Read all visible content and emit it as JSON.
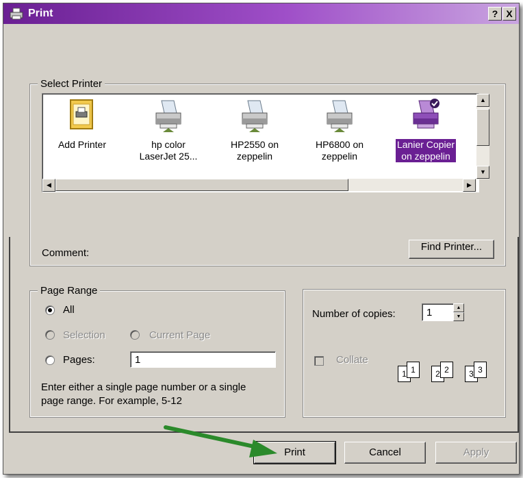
{
  "window": {
    "title": "Print",
    "help_label": "?",
    "close_label": "X"
  },
  "select_printer": {
    "legend": "Select Printer",
    "printers": [
      {
        "label_line1": "Add Printer",
        "label_line2": "",
        "icon": "add-printer-icon",
        "selected": false
      },
      {
        "label_line1": "hp color",
        "label_line2": "LaserJet 25...",
        "icon": "printer-icon",
        "selected": false
      },
      {
        "label_line1": "HP2550 on",
        "label_line2": "zeppelin",
        "icon": "printer-icon",
        "selected": false
      },
      {
        "label_line1": "HP6800 on",
        "label_line2": "zeppelin",
        "icon": "printer-icon",
        "selected": false
      },
      {
        "label_line1": "Lanier Copier",
        "label_line2": "on zeppelin",
        "icon": "default-printer-icon",
        "selected": true
      }
    ],
    "comment_label": "Comment:",
    "find_printer_label": "Find Printer..."
  },
  "page_range": {
    "legend": "Page Range",
    "all_label": "All",
    "selection_label": "Selection",
    "current_page_label": "Current Page",
    "pages_label": "Pages:",
    "pages_value": "1",
    "hint_line1": "Enter either a single page number or a single",
    "hint_line2": "page range.  For example, 5-12",
    "selected_option": "All"
  },
  "copies": {
    "number_label": "Number of copies:",
    "number_value": "1",
    "collate_label": "Collate",
    "collate_checked": false,
    "collate_pages": [
      "1",
      "1",
      "2",
      "2",
      "3",
      "3"
    ]
  },
  "buttons": {
    "print": "Print",
    "cancel": "Cancel",
    "apply": "Apply"
  },
  "colors": {
    "titlebar": "#6a1f93",
    "selection": "#6a1f93",
    "dialog_face": "#d4d0c8",
    "annotation_arrow": "#2b8a2b"
  }
}
